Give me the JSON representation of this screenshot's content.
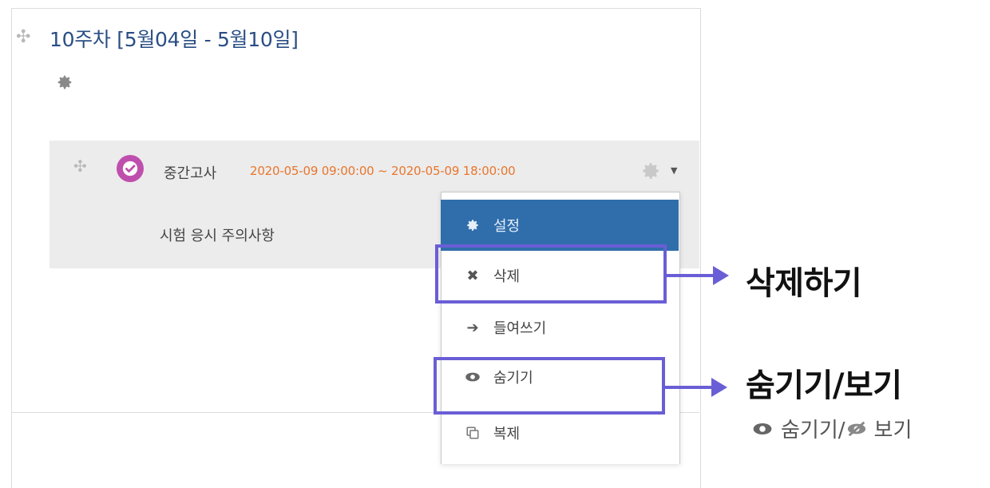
{
  "section": {
    "title": "10주차 [5월04일 - 5월10일]"
  },
  "activity": {
    "name": "중간고사",
    "dates": "2020-05-09 09:00:00 ~ 2020-05-09 18:00:00",
    "description": "시험 응시 주의사항",
    "icon_color": "#bf4fad"
  },
  "menu": {
    "items": [
      {
        "label": "설정",
        "icon": "gear-icon"
      },
      {
        "label": "삭제",
        "icon": "close-icon"
      },
      {
        "label": "들여쓰기",
        "icon": "arrow-right-icon"
      },
      {
        "label": "숨기기",
        "icon": "eye-icon"
      },
      {
        "label": "복제",
        "icon": "copy-icon"
      }
    ],
    "selected_bg": "#2f6eab"
  },
  "annotations": {
    "delete_label": "삭제하기",
    "hide_label": "숨기기/보기",
    "legend_hide": "숨기기/",
    "legend_show": "보기",
    "highlight_color": "#6a5ed6"
  }
}
